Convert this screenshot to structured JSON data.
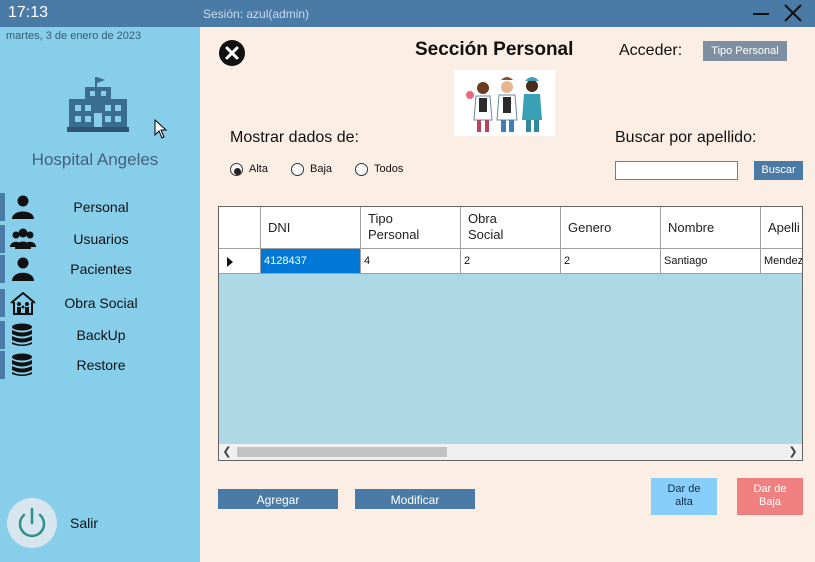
{
  "topbar": {
    "time": "17:13",
    "session": "Sesión: azul(admin)"
  },
  "sidebar": {
    "date": "martes, 3 de enero de 2023",
    "hospital_name": "Hospital Angeles",
    "items": [
      {
        "label": "Personal",
        "icon": "person-icon"
      },
      {
        "label": "Usuarios",
        "icon": "users-group-icon"
      },
      {
        "label": "Pacientes",
        "icon": "patient-icon"
      },
      {
        "label": "Obra Social",
        "icon": "family-house-icon"
      },
      {
        "label": "BackUp",
        "icon": "database-icon"
      },
      {
        "label": "Restore",
        "icon": "database-icon"
      }
    ],
    "exit_label": "Salir"
  },
  "main": {
    "title": "Sección Personal",
    "access_label": "Acceder:",
    "tipo_personal_button": "Tipo Personal",
    "show_label": "Mostrar dados de:",
    "radios": [
      {
        "label": "Alta",
        "checked": true
      },
      {
        "label": "Baja",
        "checked": false
      },
      {
        "label": "Todos",
        "checked": false
      }
    ],
    "search_label": "Buscar por apellido:",
    "search_value": "",
    "search_button": "Buscar"
  },
  "grid": {
    "columns": [
      "DNI",
      "Tipo\nPersonal",
      "Obra\nSocial",
      "Genero",
      "Nombre",
      "Apelli"
    ],
    "rows": [
      [
        "4128437",
        "4",
        "2",
        "2",
        "Santiago",
        "Mendez"
      ]
    ]
  },
  "buttons": {
    "add": "Agregar",
    "modify": "Modificar",
    "activate_line1": "Dar de",
    "activate_line2": "alta",
    "deactivate_line1": "Dar de",
    "deactivate_line2": "Baja"
  },
  "colors": {
    "topbar": "#4a7aa6",
    "sidebar": "#87ceeb",
    "main_bg": "#fbeee4",
    "grid_bg": "#add8e6",
    "selected_cell": "#0078d7",
    "activate": "#87cefa",
    "deactivate": "#f08080"
  }
}
